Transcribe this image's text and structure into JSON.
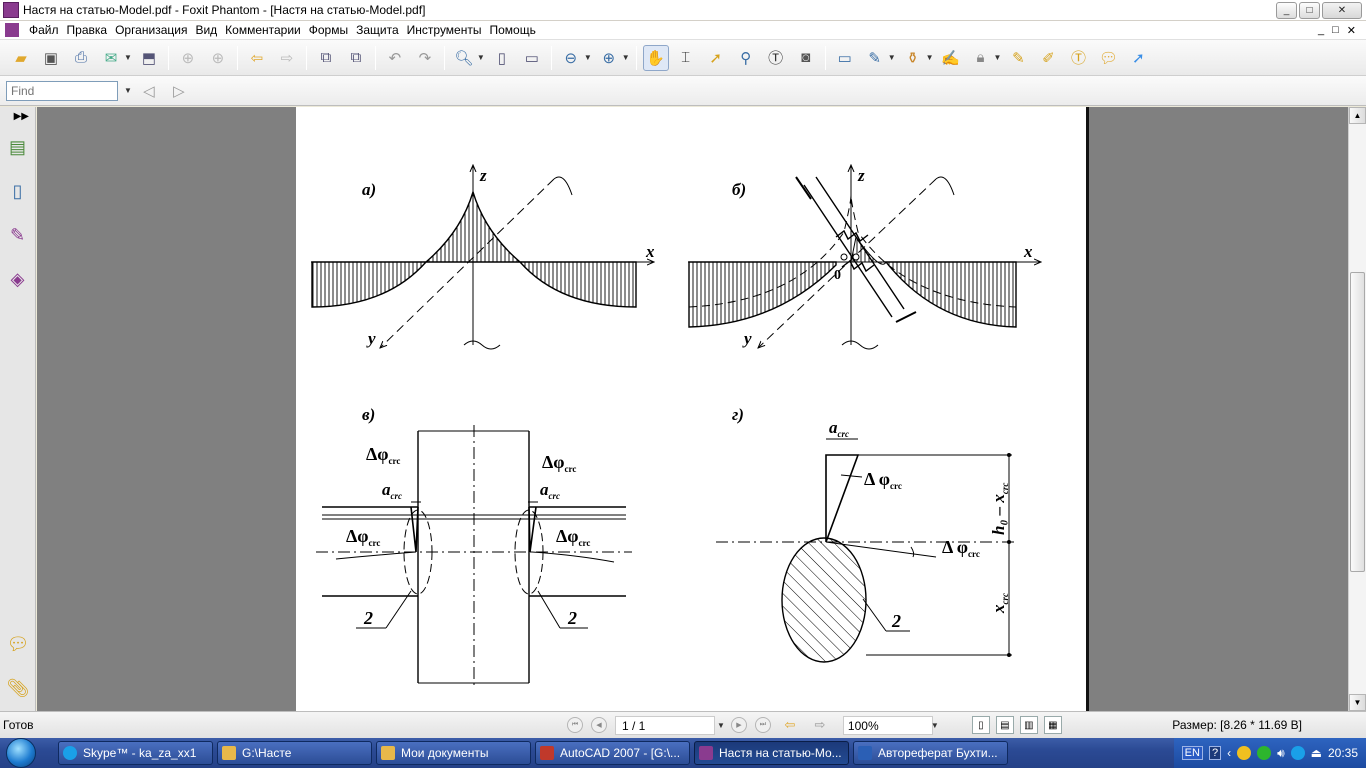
{
  "window": {
    "title": "Настя на статью-Model.pdf - Foxit Phantom - [Настя на статью-Model.pdf]",
    "minimize_glyph": "_",
    "maximize_glyph": "□",
    "close_glyph": "✕"
  },
  "menu": {
    "items": [
      "Файл",
      "Правка",
      "Организация",
      "Вид",
      "Комментарии",
      "Формы",
      "Защита",
      "Инструменты",
      "Помощь"
    ],
    "mdi_glyphs": [
      "_",
      "□",
      "✕"
    ]
  },
  "find": {
    "placeholder": "Find"
  },
  "figure": {
    "panel_a": {
      "label": "а)",
      "axis_z": "z",
      "axis_x": "x",
      "axis_y": "y"
    },
    "panel_b": {
      "label": "б)",
      "axis_z": "z",
      "axis_x": "x",
      "axis_y": "y",
      "origin": "0"
    },
    "panel_v": {
      "label": "в)",
      "delta_phi_left": "Δφ",
      "delta_phi_right": "Δφ",
      "a_crc_left": "a",
      "a_crc_right": "a",
      "delta_phi_low_left": "Δφ",
      "delta_phi_low_right": "Δφ",
      "sub_crc": "crc",
      "callout_left": "2",
      "callout_right": "2"
    },
    "panel_g": {
      "label": "г)",
      "a_crc": "a",
      "sub_crc": "crc",
      "delta_phi_top": "Δ φ",
      "delta_phi_right": "Δ φ",
      "dim_upper": "h₀ – x",
      "dim_lower": "x",
      "callout": "2"
    }
  },
  "status": {
    "ready": "Готов",
    "page": "1 / 1",
    "zoom": "100%",
    "size": "Размер: [8.26 * 11.69 В]"
  },
  "taskbar": {
    "items": [
      {
        "label": "Skype™ - ka_za_xx1",
        "color": "#1aa0e8"
      },
      {
        "label": "G:\\Насте",
        "color": "#e8b84a"
      },
      {
        "label": "Мои документы",
        "color": "#e8b84a"
      },
      {
        "label": "AutoCAD 2007 - [G:\\...",
        "color": "#c0392b"
      },
      {
        "label": "Настя на статью-Мо...",
        "color": "#8a3b8f"
      },
      {
        "label": "Автореферат Бухти...",
        "color": "#2b5fb5"
      }
    ],
    "lang": "EN",
    "help": "?",
    "clock": "20:35"
  }
}
